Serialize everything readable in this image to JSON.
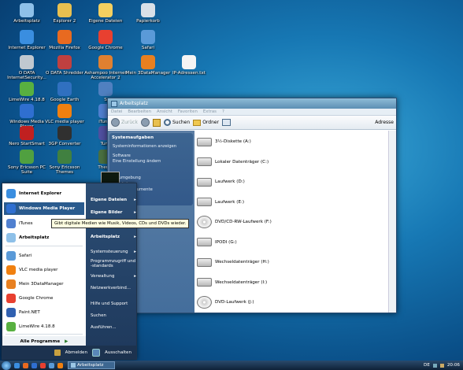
{
  "desktop_icons": [
    {
      "label": "Arbeitsplatz",
      "color": "#8ec0e8"
    },
    {
      "label": "Explorer 2",
      "color": "#e8c050"
    },
    {
      "label": "Eigene Dateien",
      "color": "#f4d060"
    },
    {
      "label": "Papierkorb",
      "color": "#d8e0e8"
    },
    {
      "label": "Internet Explorer",
      "color": "#3a8ee0"
    },
    {
      "label": "Mozilla Firefox",
      "color": "#e86a20"
    },
    {
      "label": "Google Chrome",
      "color": "#e84030"
    },
    {
      "label": "Safari",
      "color": "#5a9ad8"
    },
    {
      "label": "O DATA InternetSecurity...",
      "color": "#c0c8d0"
    },
    {
      "label": "O DATA Shredder",
      "color": "#c04040"
    },
    {
      "label": "Ashampoo Internet Accelerator 2",
      "color": "#e08030"
    },
    {
      "label": "Mein 3DataManager",
      "color": "#e88020"
    },
    {
      "label": "IP-Adressen.txt",
      "color": "#f4f4f4"
    },
    {
      "label": "LimeWire 4.18.8",
      "color": "#58b040"
    },
    {
      "label": "Google Earth",
      "color": "#3070c0"
    },
    {
      "label": "S",
      "color": "#5080c0"
    },
    {
      "label": "Windows Media Player",
      "color": "#2f6fd0"
    },
    {
      "label": "VLC media player",
      "color": "#f08010"
    },
    {
      "label": "iTunes",
      "color": "#5080d0"
    },
    {
      "label": "Nero StartSmart",
      "color": "#c02020"
    },
    {
      "label": "3GP Converter",
      "color": "#303030"
    },
    {
      "label": "Tune",
      "color": "#5050a0"
    },
    {
      "label": "Sony Ericsson PC Suite",
      "color": "#50a040"
    },
    {
      "label": "Sony Ericsson Themes",
      "color": "#408040"
    },
    {
      "label": "Thema",
      "color": "#4a7040"
    }
  ],
  "explorer": {
    "title": "Arbeitsplatz",
    "menu": [
      "Datei",
      "Bearbeiten",
      "Ansicht",
      "Favoriten",
      "Extras",
      "?"
    ],
    "toolbar": {
      "back": "Zurück",
      "search": "Suchen",
      "folders": "Ordner",
      "address": "Adresse"
    },
    "tasks_title": "Systemaufgaben",
    "tasks": [
      "Systeminformationen anzeigen",
      "Software",
      "Eine Einstellung ändern",
      "...kumgebung",
      "...Dateien",
      "...same Dokumente",
      "...steuerung",
      "...tz"
    ],
    "drives": [
      {
        "label": "3½-Diskette (A:)",
        "kind": "floppy"
      },
      {
        "label": "Lokaler Datenträger (C:)",
        "kind": "hdd"
      },
      {
        "label": "Laufwerk (D:)",
        "kind": "hdd"
      },
      {
        "label": "Laufwerk (E:)",
        "kind": "hdd"
      },
      {
        "label": "DVD/CD-RW-Laufwerk (F:)",
        "kind": "cd"
      },
      {
        "label": "IPODI (G:)",
        "kind": "hdd"
      },
      {
        "label": "Wechseldatenträger (H:)",
        "kind": "hdd"
      },
      {
        "label": "Wechseldatenträger (I:)",
        "kind": "hdd"
      },
      {
        "label": "DVD-Laufwerk (J:)",
        "kind": "cd"
      }
    ]
  },
  "start_menu": {
    "left_items": [
      {
        "label": "Internet Explorer",
        "color": "#3a8ee0",
        "bold": true
      },
      {
        "label": "Windows Media Player",
        "color": "#2f6fd0",
        "bold": true
      },
      {
        "label": "iTunes",
        "color": "#5080d0",
        "bold": false
      },
      {
        "label": "Arbeitsplatz",
        "color": "#8ec0e8",
        "bold": true
      },
      {
        "label": "Safari",
        "color": "#5a9ad8",
        "bold": false
      },
      {
        "label": "VLC media player",
        "color": "#f08010",
        "bold": false
      },
      {
        "label": "Mein 3DataManager",
        "color": "#e88020",
        "bold": false
      },
      {
        "label": "Google Chrome",
        "color": "#e84030",
        "bold": false
      },
      {
        "label": "Paint.NET",
        "color": "#3060b0",
        "bold": false
      },
      {
        "label": "LimeWire 4.18.8",
        "color": "#58b040",
        "bold": false
      }
    ],
    "all_programs": "Alle Programme",
    "right_items": [
      {
        "label": "Eigene Dateien",
        "arrow": "▸"
      },
      {
        "label": "Eigene Bilder",
        "arrow": "▸"
      },
      {
        "label": "",
        "arrow": "▸"
      },
      {
        "label": "Arbeitsplatz",
        "arrow": "▸"
      },
      {
        "label": "Systemsteuerung",
        "arrow": "▸"
      },
      {
        "label": "Programmzugriff und -standards",
        "arrow": ""
      },
      {
        "label": "Verwaltung",
        "arrow": "▸"
      },
      {
        "label": "Netzwerkverbind...",
        "arrow": ""
      },
      {
        "label": "Hilfe und Support",
        "arrow": ""
      },
      {
        "label": "Suchen",
        "arrow": ""
      },
      {
        "label": "Ausführen...",
        "arrow": ""
      }
    ],
    "logoff": "Abmelden",
    "shutdown": "Ausschalten",
    "tooltip": "Gibt digitale Medien wie Musik, Videos, CDs und DVDs wieder."
  },
  "taskbar": {
    "task": "Arbeitsplatz",
    "lang": "DE",
    "clock": "20:06"
  }
}
